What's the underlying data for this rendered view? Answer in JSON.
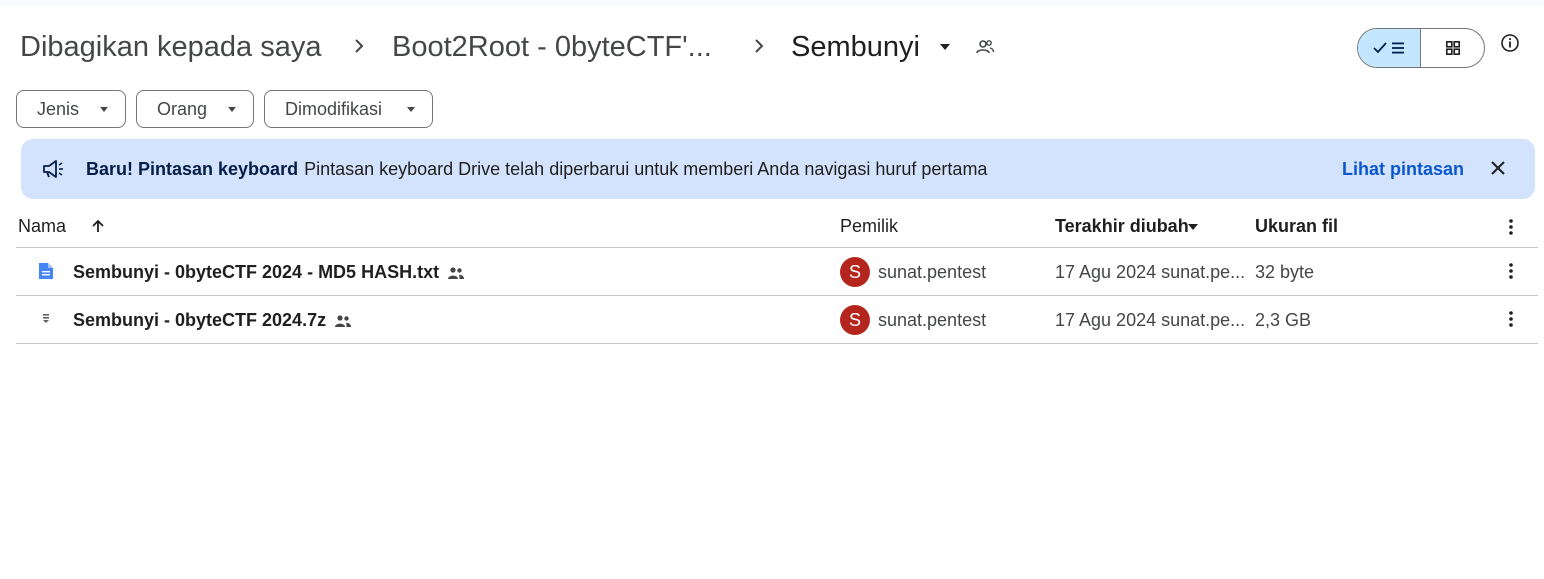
{
  "breadcrumb": {
    "items": [
      "Dibagikan kepada saya",
      "Boot2Root - 0byteCTF'..."
    ],
    "current": "Sembunyi"
  },
  "filters": [
    "Jenis",
    "Orang",
    "Dimodifikasi"
  ],
  "banner": {
    "title": "Baru! Pintasan keyboard",
    "message": "Pintasan keyboard Drive telah diperbarui untuk memberi Anda navigasi huruf pertama",
    "link": "Lihat pintasan"
  },
  "table": {
    "columns": {
      "name": "Nama",
      "owner": "Pemilik",
      "modified": "Terakhir diubah",
      "size": "Ukuran file"
    },
    "rows": [
      {
        "name": "Sembunyi - 0byteCTF 2024 - MD5 HASH.txt",
        "icon": "doc-icon",
        "owner_initial": "S",
        "owner": "sunat.pentest",
        "modified": "17 Agu 2024 sunat.pe...",
        "size": "32 byte"
      },
      {
        "name": "Sembunyi - 0byteCTF 2024.7z",
        "icon": "archive-icon",
        "owner_initial": "S",
        "owner": "sunat.pentest",
        "modified": "17 Agu 2024 sunat.pe...",
        "size": "2,3 GB"
      }
    ]
  },
  "colors": {
    "banner_bg": "#d3e3fd",
    "toggle_active": "#c2e7ff",
    "avatar": "#b3261e",
    "link": "#0b57d0",
    "doc_icon": "#4285f4"
  }
}
